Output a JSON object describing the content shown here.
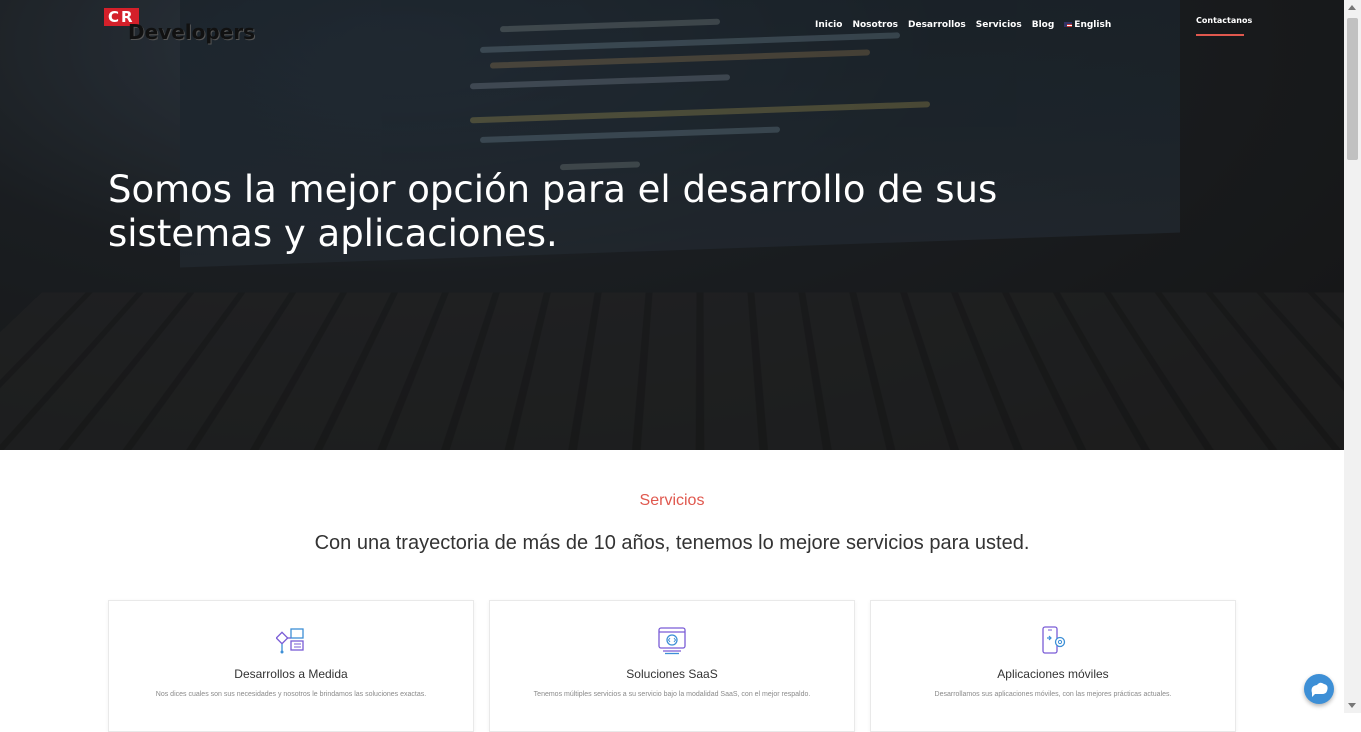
{
  "header": {
    "logo_cr": "CR",
    "logo_text": "Developers",
    "nav": [
      {
        "label": "Inicio"
      },
      {
        "label": "Nosotros"
      },
      {
        "label": "Desarrollos"
      },
      {
        "label": "Servicios"
      },
      {
        "label": "Blog"
      },
      {
        "label": "English",
        "icon": "us-flag-icon"
      }
    ],
    "cta": "Contactanos"
  },
  "hero": {
    "title": "Somos la mejor opción para el desarrollo de sus sistemas y aplicaciones."
  },
  "services": {
    "label": "Servicios",
    "subtitle": "Con una trayectoria de más de 10 años, tenemos lo mejore servicios para usted.",
    "cards": [
      {
        "icon": "flowchart-icon",
        "title": "Desarrollos a Medida",
        "desc": "Nos dices cuales son sus necesidades y nosotros le brindamos las soluciones exactas."
      },
      {
        "icon": "browser-code-icon",
        "title": "Soluciones SaaS",
        "desc": "Tenemos múltiples servicios a su servicio bajo la modalidad SaaS, con el mejor respaldo."
      },
      {
        "icon": "mobile-settings-icon",
        "title": "Aplicaciones móviles",
        "desc": "Desarrollamos sus aplicaciones móviles, con las mejores prácticas actuales."
      }
    ]
  },
  "colors": {
    "accent": "#e0584e",
    "icon_primary": "#7a5cd6",
    "icon_secondary": "#3d8fd6",
    "chat": "#3d8fd6"
  },
  "chat": {
    "icon": "chat-bubble-icon"
  }
}
